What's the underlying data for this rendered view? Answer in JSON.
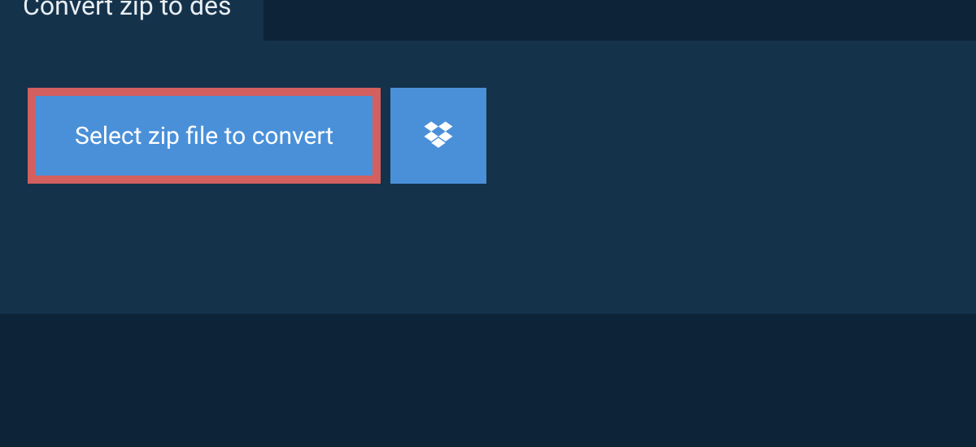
{
  "tab": {
    "label": "Convert zip to des"
  },
  "upload": {
    "select_label": "Select zip file to convert"
  },
  "colors": {
    "page_bg": "#0d2438",
    "panel_bg": "#15324b",
    "button_bg": "#4a90d9",
    "highlight_border": "#d35f5f",
    "text_light": "#e8eef3"
  }
}
